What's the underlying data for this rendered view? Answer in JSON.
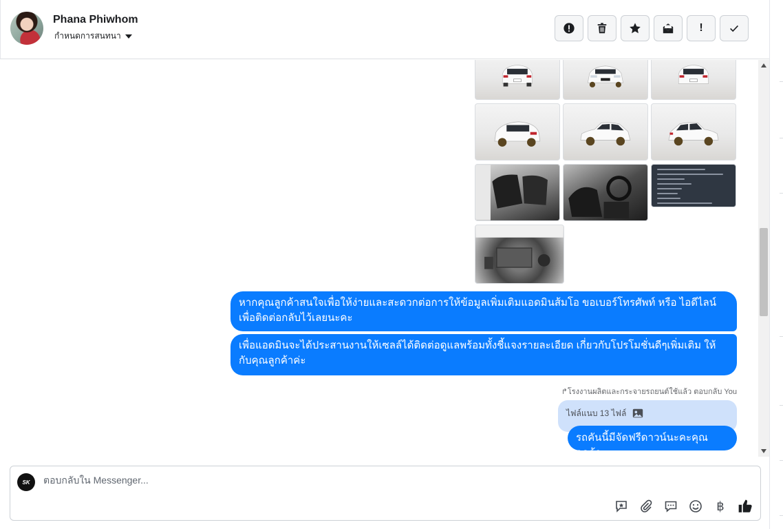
{
  "header": {
    "name": "Phana Phiwhom",
    "assign_label": "กำหนดการสนทนา"
  },
  "toolbar": {
    "buttons": [
      {
        "icon": "alert-circle-icon"
      },
      {
        "icon": "trash-icon"
      },
      {
        "icon": "star-icon"
      },
      {
        "icon": "mail-unread-icon"
      },
      {
        "icon": "exclamation-icon",
        "glyph": "!"
      },
      {
        "icon": "check-icon"
      }
    ]
  },
  "thread": {
    "messages": [
      {
        "text": "หากคุณลูกค้าสนใจเพื่อให้ง่ายและสะดวกต่อการให้ข้อมูลเพิ่มเติมแอดมินส้มโอ ขอเบอร์โทรศัพท์ หรือ ไอดีไลน์ เพื่อติดต่อกลับไว้เลยนะคะ"
      },
      {
        "text": "เพื่อแอดมินจะได้ประสานงานให้เซลล์ได้ติดต่อดูแลพร้อมทั้งชี้แจงรายละเอียด เกี่ยวกับโปรโมชั่นดีๆเพิ่มเติม ให้กับคุณลูกค้าค่ะ"
      }
    ],
    "reply_note": "โรงงานผลิตและกระจายรถยนต์ใช้แล้ว ตอบกลับ You",
    "quoted_text": "ไฟล์แนบ 13 ไฟล์",
    "reply_message": "รถคันนี้มีจัดฟรีดาวน์นะคะคุณลูกค้า"
  },
  "composer": {
    "placeholder": "ตอบกลับใน Messenger...",
    "page_avatar_text": "SK",
    "currency_glyph": "฿"
  },
  "colors": {
    "accent": "#0a7cff",
    "quote_bg": "#cfe1fb"
  }
}
